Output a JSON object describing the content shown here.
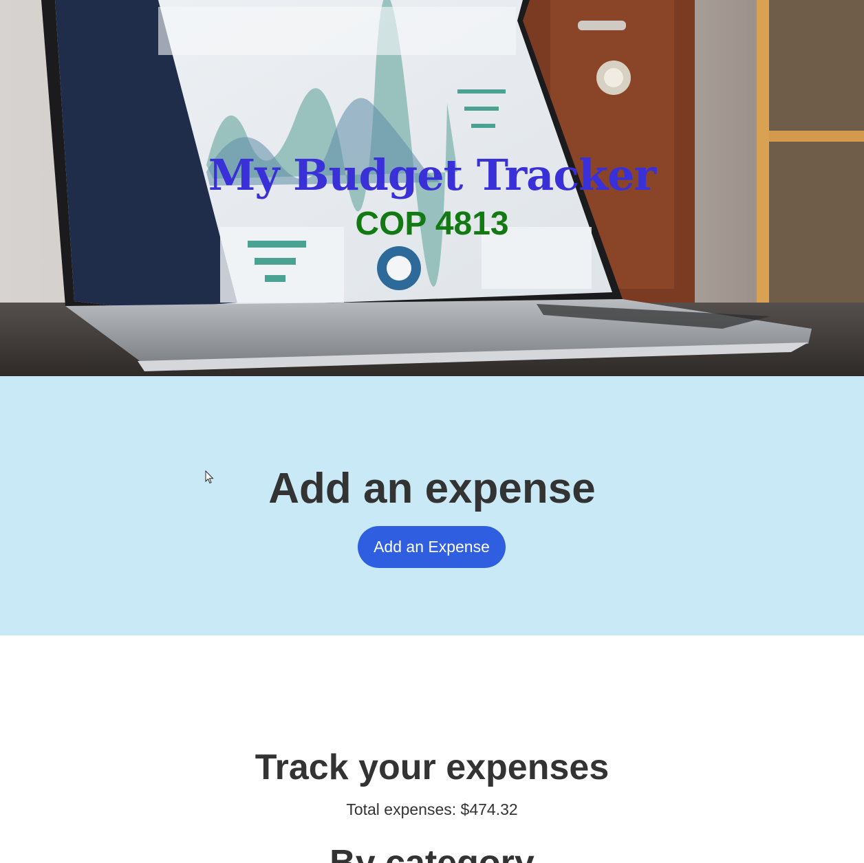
{
  "hero": {
    "title": "My Budget Tracker",
    "subtitle": "COP 4813",
    "title_color": "#3a30d8",
    "subtitle_color": "#137a13"
  },
  "add_expense": {
    "heading": "Add an expense",
    "button_label": "Add an Expense",
    "background_color": "#cae9f7",
    "button_color": "#2f5fe0"
  },
  "track": {
    "heading": "Track your expenses",
    "total_text": "Total expenses: $474.32",
    "category_heading": "By category"
  },
  "icons": {
    "cursor": "mouse-pointer-icon"
  }
}
